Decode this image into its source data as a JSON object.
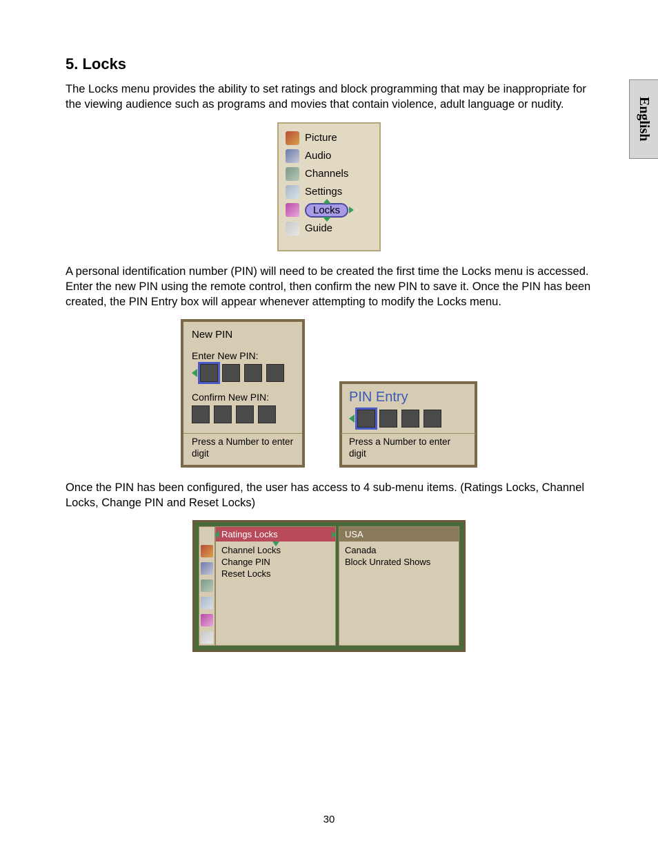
{
  "heading": "5. Locks",
  "para1": "The Locks menu provides the ability to set ratings and block programming that may be inappropriate for the viewing audience such as programs and movies that contain violence, adult language or nudity.",
  "para2": "A personal identification number (PIN) will need to be created the first time the Locks menu is accessed. Enter the new PIN using the remote control, then confirm the new PIN to save it. Once the PIN has been created, the PIN Entry box will appear whenever attempting to modify the Locks menu.",
  "para3": "Once the PIN has been configured, the user has access to 4 sub-menu items. (Ratings Locks, Channel Locks, Change PIN and Reset Locks)",
  "side_tab": "English",
  "page_number": "30",
  "main_menu": {
    "items": [
      "Picture",
      "Audio",
      "Channels",
      "Settings",
      "Locks",
      "Guide"
    ],
    "selected": "Locks"
  },
  "new_pin_dialog": {
    "title": "New PIN",
    "enter_label": "Enter New PIN:",
    "confirm_label": "Confirm New PIN:",
    "hint": "Press a Number to enter digit"
  },
  "pin_entry_dialog": {
    "title": "PIN Entry",
    "hint": "Press a Number to enter digit"
  },
  "submenu": {
    "left": {
      "header": "Ratings Locks",
      "items": [
        "Channel Locks",
        "Change PIN",
        "Reset Locks"
      ]
    },
    "right": {
      "header": "USA",
      "items": [
        "Canada",
        "Block Unrated Shows"
      ]
    }
  }
}
